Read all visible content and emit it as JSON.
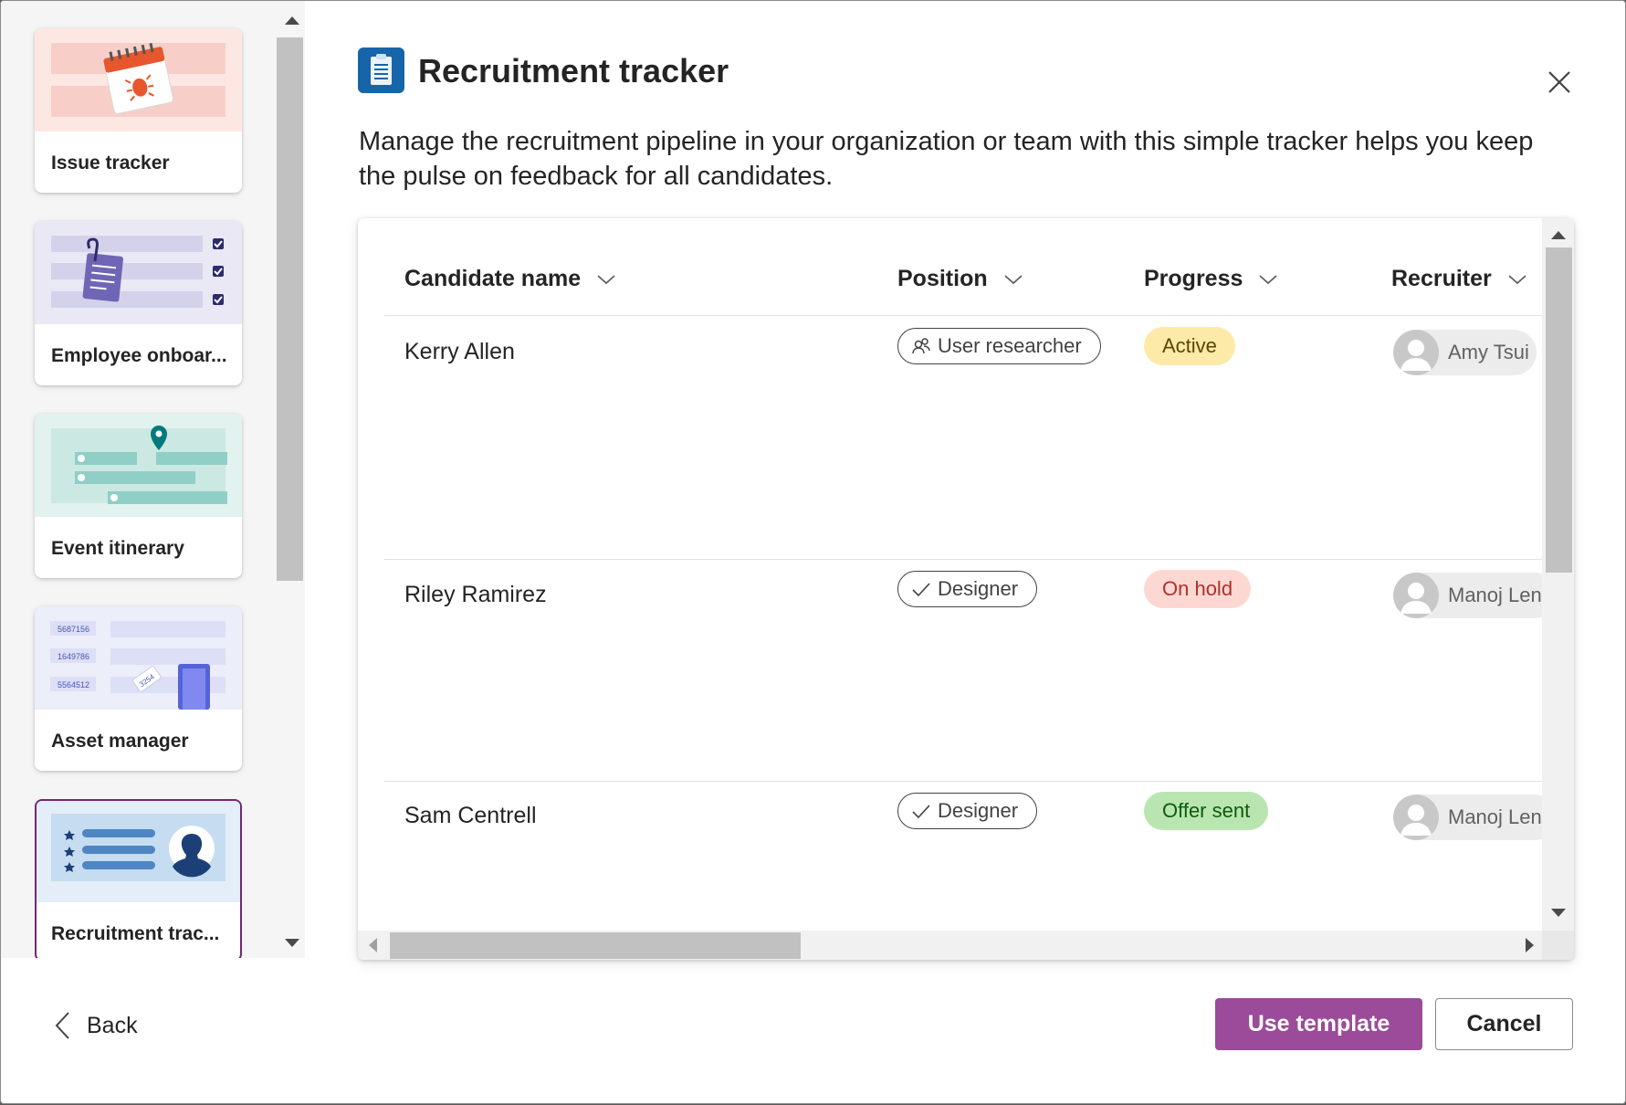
{
  "gallery": {
    "items": [
      {
        "label": "Issue tracker",
        "icon": "calendar-bug-icon"
      },
      {
        "label": "Employee onboar...",
        "icon": "clipboard-checklist-icon"
      },
      {
        "label": "Event itinerary",
        "icon": "map-pin-icon"
      },
      {
        "label": "Asset manager",
        "icon": "asset-tag-phone-icon",
        "codes": [
          "5687156",
          "1649786",
          "5564512"
        ],
        "tag": "3254"
      },
      {
        "label": "Recruitment trac...",
        "icon": "candidate-profile-icon",
        "selected": true
      }
    ]
  },
  "template": {
    "title": "Recruitment tracker",
    "description": "Manage the recruitment pipeline in your organization or team with this simple tracker helps you keep the pulse on feedback for all candidates."
  },
  "table": {
    "columns": [
      "Candidate name",
      "Position",
      "Progress",
      "Recruiter"
    ],
    "rows": [
      {
        "name": "Kerry Allen",
        "position": "User researcher",
        "position_icon": "people-icon",
        "progress": "Active",
        "recruiter": "Amy Tsui"
      },
      {
        "name": "Riley Ramirez",
        "position": "Designer",
        "position_icon": "checkmark-icon",
        "progress": "On hold",
        "recruiter": "Manoj Lenka"
      },
      {
        "name": "Sam Centrell",
        "position": "Designer",
        "position_icon": "checkmark-icon",
        "progress": "Offer sent",
        "recruiter": "Manoj Lenka"
      }
    ]
  },
  "footer": {
    "back_label": "Back",
    "use_label": "Use template",
    "cancel_label": "Cancel"
  },
  "colors": {
    "accent": "#9b4b9a",
    "selected_border": "#742774",
    "active_bg": "#fdeaa8",
    "onhold_bg": "#fdd8d3",
    "onhold_text": "#b1302b",
    "offer_bg": "#b9e6b0",
    "app_icon": "#1565a8"
  }
}
